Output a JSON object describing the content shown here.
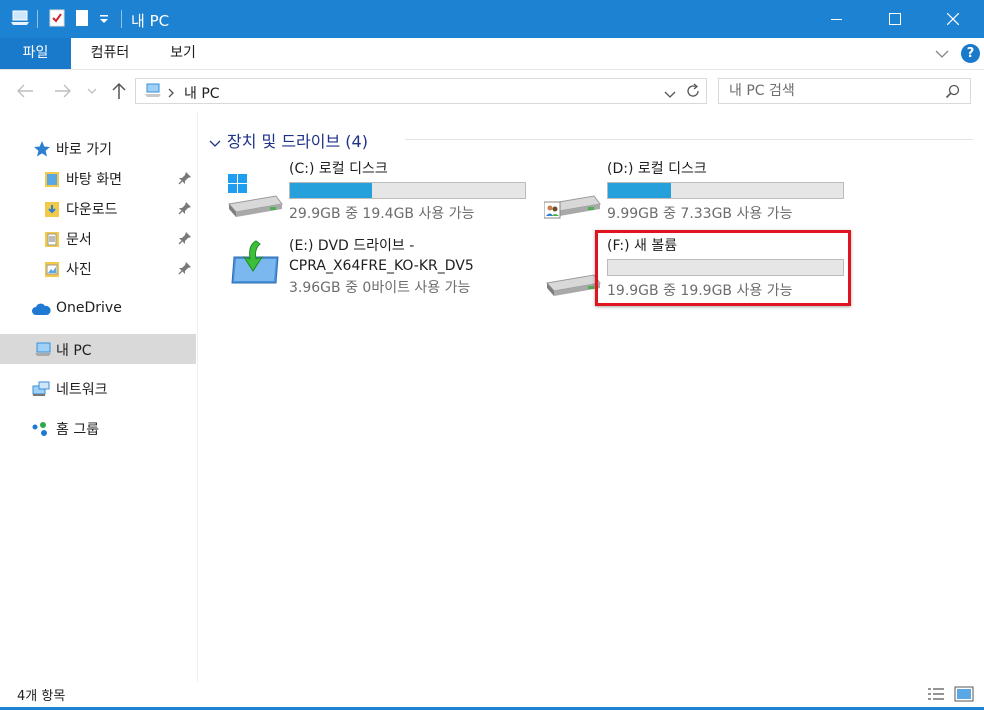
{
  "window": {
    "title": "내 PC"
  },
  "ribbon": {
    "tabs": [
      "파일",
      "컴퓨터",
      "보기"
    ],
    "help_label": "?"
  },
  "navigation": {
    "address_location": "내 PC",
    "search_placeholder": "내 PC 검색"
  },
  "sidebar": {
    "quick_access": "바로 가기",
    "pinned": [
      "바탕 화면",
      "다운로드",
      "문서",
      "사진"
    ],
    "onedrive": "OneDrive",
    "this_pc": "내 PC",
    "network": "네트워크",
    "homegroup": "홈 그룹"
  },
  "content": {
    "group_title": "장치 및 드라이브 (4)",
    "drives": [
      {
        "name": "(C:) 로컬 디스크",
        "size_text": "29.9GB 중 19.4GB 사용 가능",
        "used_fraction": 0.35,
        "icon": "windows-drive-icon"
      },
      {
        "name": "(D:) 로컬 디스크",
        "size_text": "9.99GB 중 7.33GB 사용 가능",
        "used_fraction": 0.27,
        "icon": "user-drive-icon"
      },
      {
        "name_line1": "(E:) DVD 드라이브 -",
        "name_line2": "CPRA_X64FRE_KO-KR_DV5",
        "size_text": "3.96GB 중 0바이트 사용 가능",
        "icon": "dvd-drive-icon"
      },
      {
        "name": "(F:) 새 볼륨",
        "size_text": "19.9GB 중 19.9GB 사용 가능",
        "used_fraction": 0.0,
        "icon": "hard-drive-icon"
      }
    ]
  },
  "status": {
    "item_count": "4개 항목"
  },
  "colors": {
    "accent": "#1e82d2",
    "bar_fill": "#26a0da",
    "highlight": "#e0141e",
    "group_title": "#1e3287"
  }
}
